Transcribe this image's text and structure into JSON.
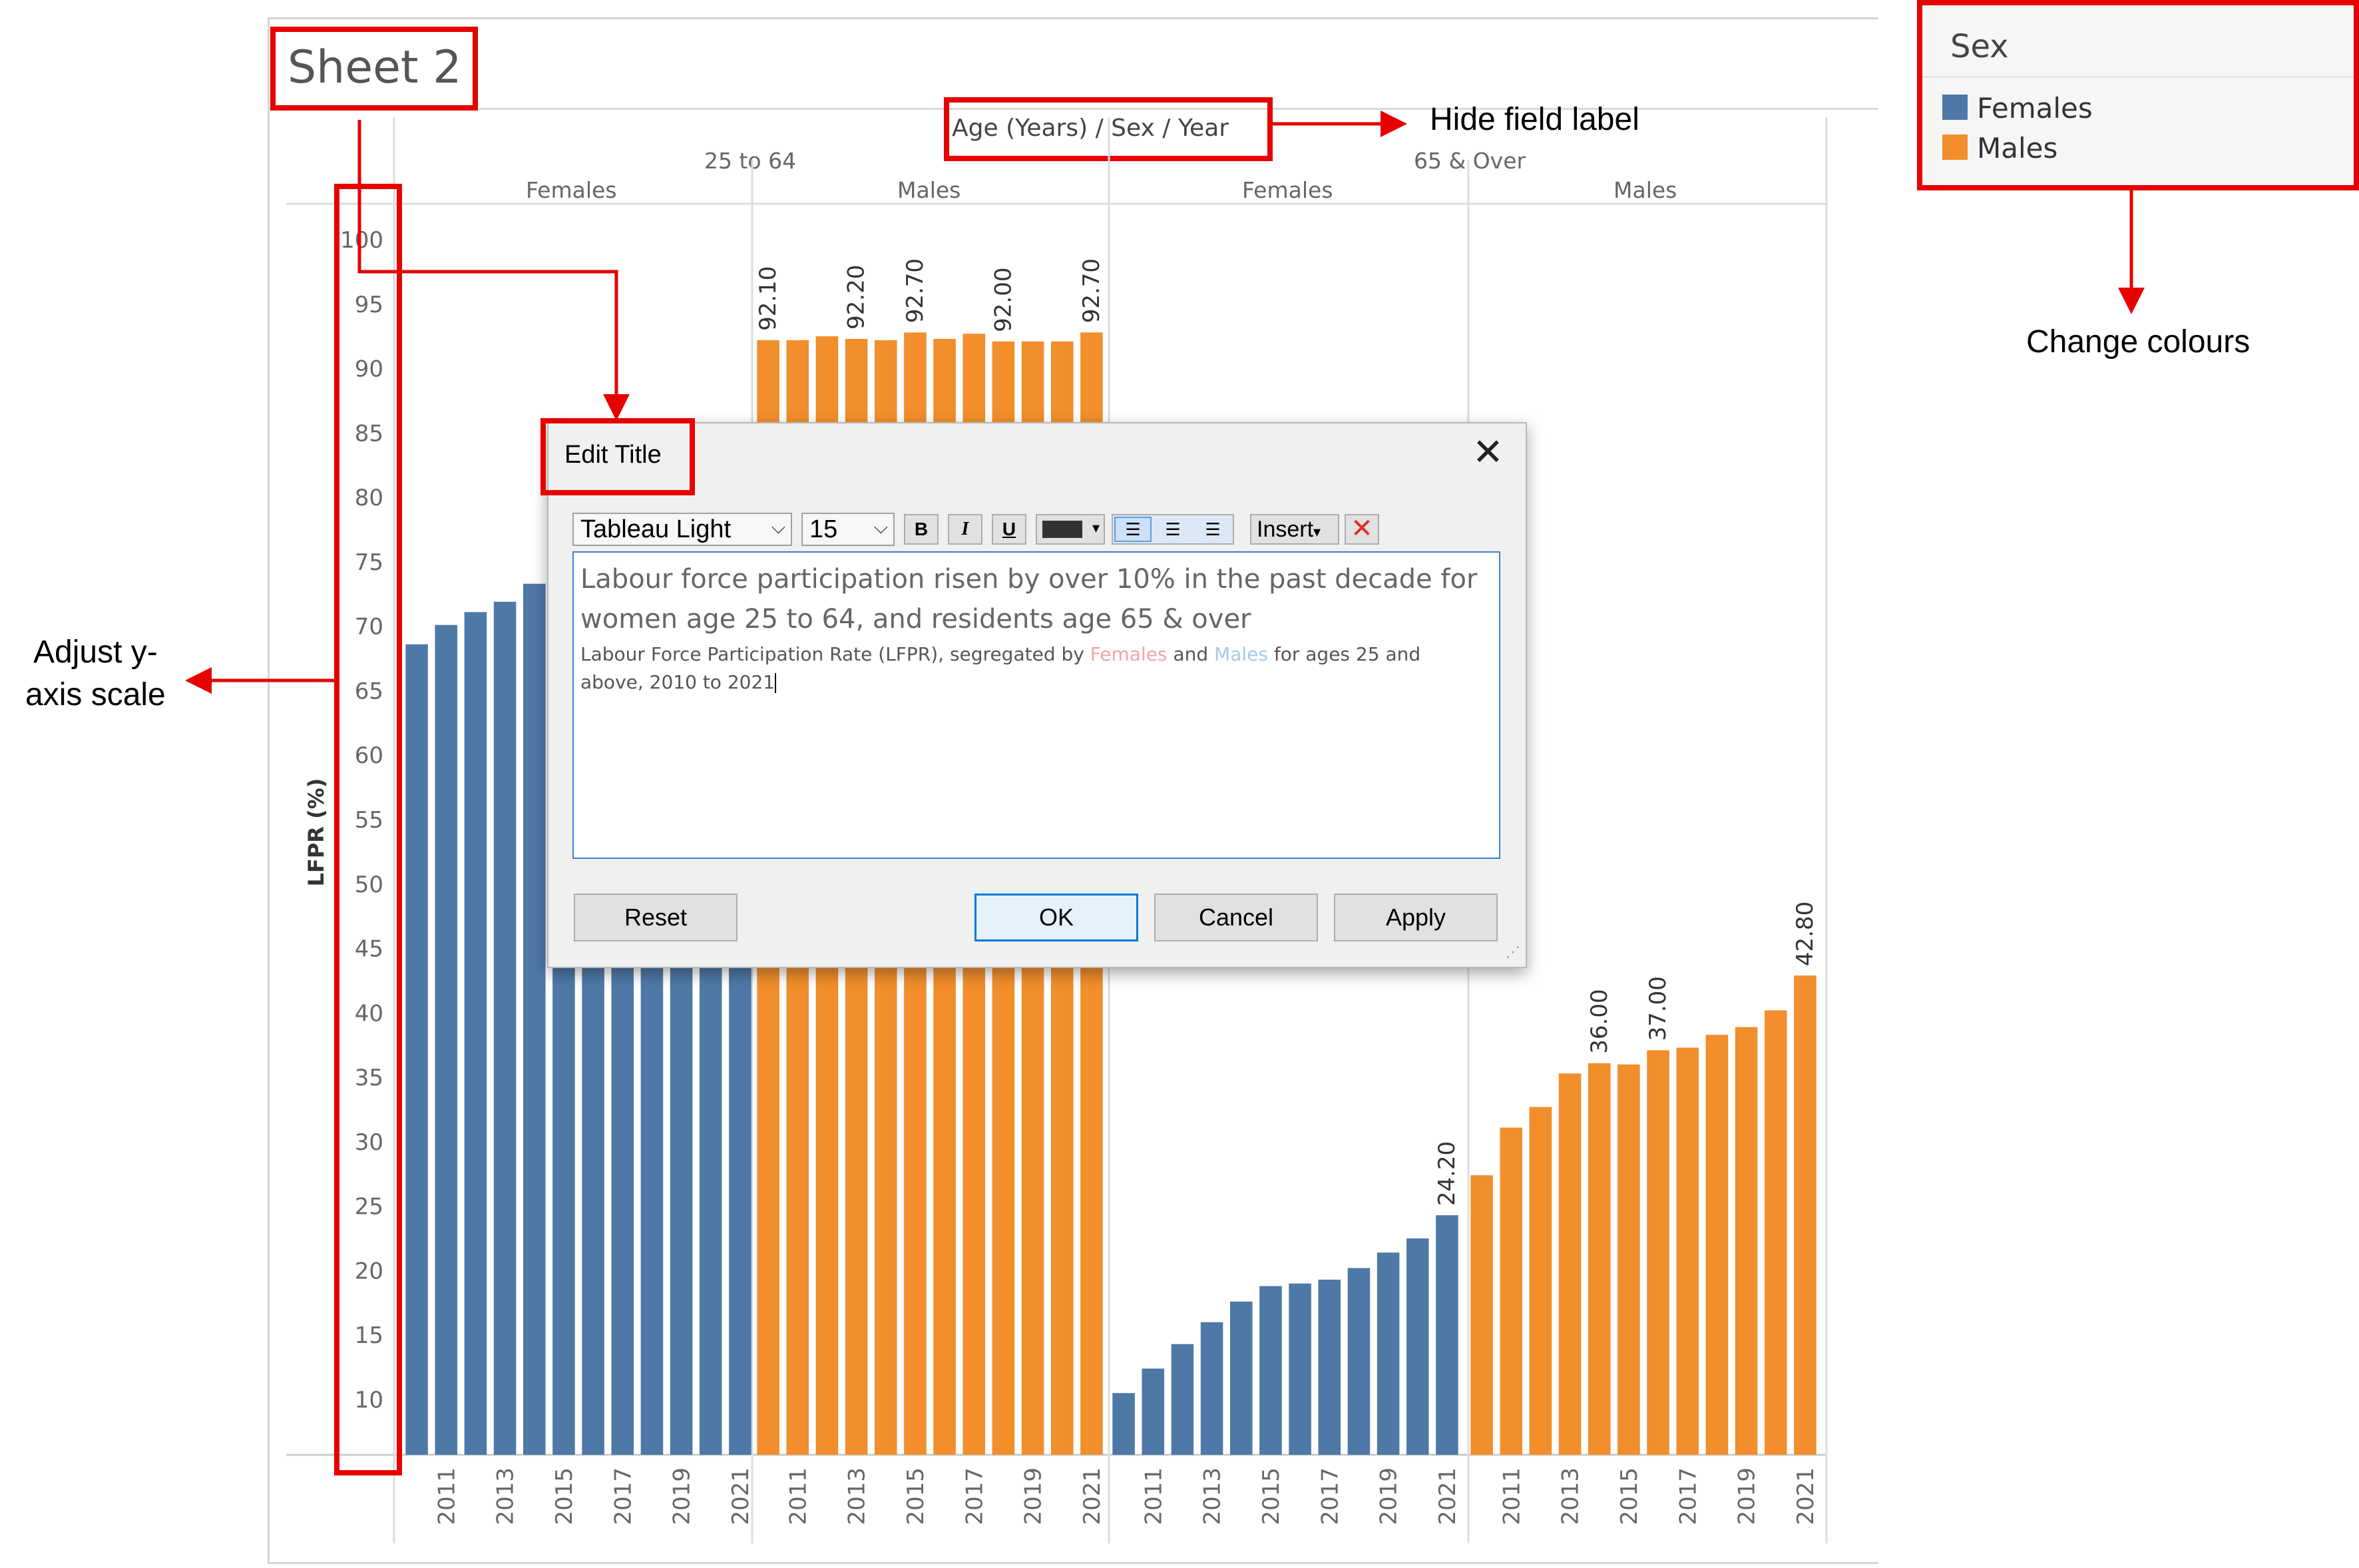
{
  "sheet": {
    "title": "Sheet 2"
  },
  "field_label": "Age (Years) / Sex / Year",
  "column_headers": {
    "age_groups": [
      "25 to 64",
      "65 & Over"
    ],
    "sexes": [
      "Females",
      "Males",
      "Females",
      "Males"
    ]
  },
  "legend": {
    "title": "Sex",
    "items": [
      {
        "label": "Females",
        "color": "#4e79a7"
      },
      {
        "label": "Males",
        "color": "#f28e2b"
      }
    ]
  },
  "annotations": {
    "hide_field_label": "Hide field label",
    "change_colours": "Change colours",
    "adjust_y_axis": "Adjust y-\naxis scale"
  },
  "chart_data": {
    "type": "bar",
    "ylabel": "LFPR (%)",
    "y_ticks": [
      "100",
      "95",
      "90",
      "85",
      "80",
      "75",
      "70",
      "65",
      "60",
      "55",
      "50",
      "45",
      "40",
      "35",
      "30",
      "25",
      "20",
      "15",
      "10"
    ],
    "ylim": [
      6.5,
      100
    ],
    "x_tick_labels": [
      "2011",
      "2013",
      "2015",
      "2017",
      "2019",
      "2021"
    ],
    "panels": [
      {
        "age": "25 to 64",
        "sex": "Females",
        "years": [
          2010,
          2011,
          2012,
          2013,
          2014,
          2015,
          2016,
          2017,
          2018,
          2019,
          2020,
          2021
        ],
        "values": [
          68.5,
          70.0,
          71.0,
          71.8,
          73.2,
          72.5,
          72.8,
          73.0,
          73.4,
          73.9,
          73.5,
          74.6
        ],
        "labels": []
      },
      {
        "age": "25 to 64",
        "sex": "Males",
        "years": [
          2010,
          2011,
          2012,
          2013,
          2014,
          2015,
          2016,
          2017,
          2018,
          2019,
          2020,
          2021
        ],
        "values": [
          92.1,
          92.1,
          92.4,
          92.2,
          92.1,
          92.7,
          92.2,
          92.6,
          92.0,
          92.0,
          92.0,
          92.7
        ],
        "labels": [
          "92.10",
          "",
          "",
          "92.20",
          "",
          "92.70",
          "",
          "",
          "92.00",
          "",
          "",
          "92.70"
        ]
      },
      {
        "age": "65 & Over",
        "sex": "Females",
        "years": [
          2010,
          2011,
          2012,
          2013,
          2014,
          2015,
          2016,
          2017,
          2018,
          2019,
          2020,
          2021
        ],
        "values": [
          10.4,
          12.3,
          14.2,
          15.9,
          17.5,
          18.7,
          18.9,
          19.2,
          20.1,
          21.3,
          22.4,
          24.2
        ],
        "labels": [
          "",
          "",
          "",
          "",
          "",
          "",
          "",
          "",
          "",
          "",
          "",
          "24.20"
        ]
      },
      {
        "age": "65 & Over",
        "sex": "Males",
        "years": [
          2010,
          2011,
          2012,
          2013,
          2014,
          2015,
          2016,
          2017,
          2018,
          2019,
          2020,
          2021
        ],
        "values": [
          27.3,
          31.0,
          32.6,
          35.2,
          36.0,
          35.9,
          37.0,
          37.2,
          38.2,
          38.8,
          40.1,
          42.8
        ],
        "labels": [
          "",
          "",
          "",
          "",
          "36.00",
          "",
          "37.00",
          "",
          "",
          "",
          "",
          "42.80"
        ]
      }
    ]
  },
  "dialog": {
    "title": "Edit Title",
    "font": "Tableau Light",
    "size": "15",
    "bold": "B",
    "italic": "I",
    "underline": "U",
    "insert": "Insert",
    "main_text": "Labour force participation risen by over 10% in the past decade for women age 25 to 64, and residents age 65 & over",
    "sub_text_1": "Labour Force Participation Rate (LFPR), segregated by ",
    "sub_females": "Females",
    "sub_and": " and ",
    "sub_males": "Males",
    "sub_text_2": " for ages 25 and above, 2010 to 2021",
    "females_color": "#f4a3a8",
    "males_color": "#a7c9e8",
    "buttons": {
      "reset": "Reset",
      "ok": "OK",
      "cancel": "Cancel",
      "apply": "Apply"
    }
  }
}
